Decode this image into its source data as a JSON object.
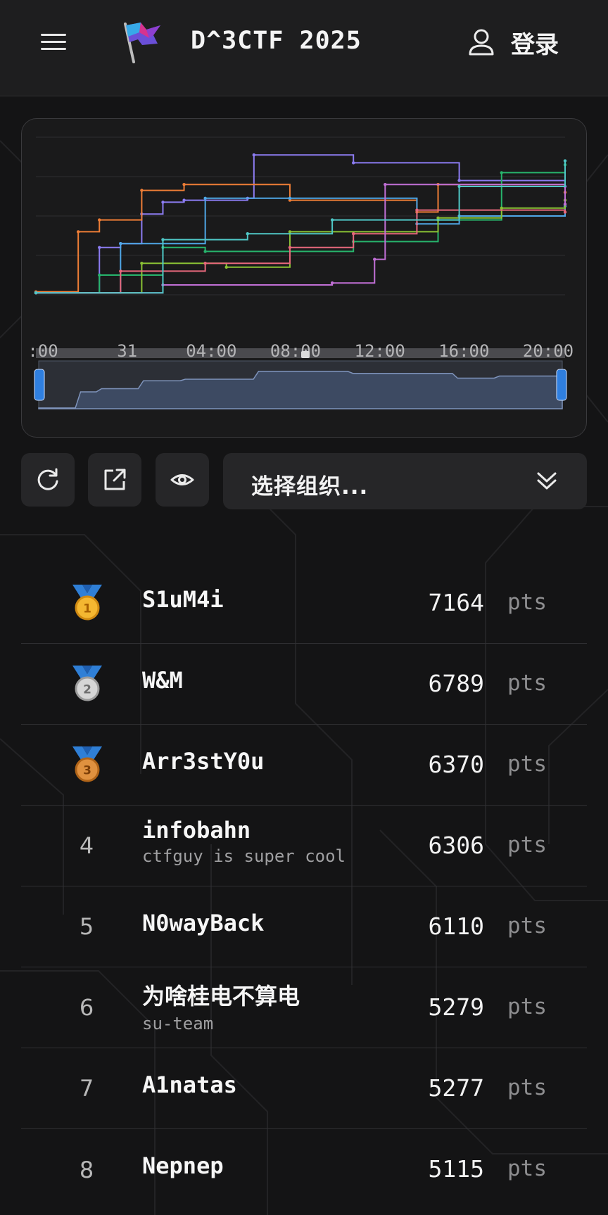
{
  "header": {
    "menu_icon": "hamburger-menu-icon",
    "logo_icon": "flag-logo-icon",
    "title": "D^3CTF 2025",
    "login_icon": "user-icon",
    "login_label": "登录"
  },
  "toolbar": {
    "refresh_icon": "refresh-icon",
    "export_icon": "external-link-icon",
    "visibility_icon": "eye-icon",
    "org_placeholder": "选择组织...",
    "org_chevron_icon": "double-chevron-down-icon"
  },
  "chart_data": {
    "type": "line",
    "x_tick_labels": [
      ":00",
      "31",
      "04:00",
      "08:00",
      "12:00",
      "16:00",
      "20:00"
    ],
    "x_range": [
      0,
      25
    ],
    "y_range": [
      0,
      8000
    ],
    "grid": true,
    "legend": "none",
    "has_range_slider": true,
    "series": [
      {
        "color": "#8c7cf2",
        "values": [
          [
            0,
            100
          ],
          [
            3,
            2400
          ],
          [
            4,
            2600
          ],
          [
            5,
            4100
          ],
          [
            6,
            4700
          ],
          [
            7,
            4800
          ],
          [
            10,
            4900
          ],
          [
            10.3,
            7100
          ],
          [
            15,
            6700
          ],
          [
            20,
            5800
          ],
          [
            25,
            5500
          ]
        ]
      },
      {
        "color": "#ee7d36",
        "values": [
          [
            0,
            150
          ],
          [
            2,
            3200
          ],
          [
            3,
            3800
          ],
          [
            5,
            5300
          ],
          [
            7,
            5600
          ],
          [
            12,
            4800
          ],
          [
            18,
            4200
          ],
          [
            19,
            5600
          ],
          [
            25,
            5200
          ]
        ]
      },
      {
        "color": "#4fa7e8",
        "values": [
          [
            0,
            100
          ],
          [
            4,
            2600
          ],
          [
            8,
            4900
          ],
          [
            12,
            4900
          ],
          [
            18,
            3600
          ],
          [
            20,
            4000
          ],
          [
            25,
            4500
          ]
        ]
      },
      {
        "color": "#27b46c",
        "values": [
          [
            0,
            100
          ],
          [
            3,
            1000
          ],
          [
            6,
            2400
          ],
          [
            8,
            2200
          ],
          [
            15,
            2700
          ],
          [
            19,
            3800
          ],
          [
            22,
            6200
          ],
          [
            25,
            6600
          ]
        ]
      },
      {
        "color": "#8ac234",
        "values": [
          [
            0,
            100
          ],
          [
            5,
            1600
          ],
          [
            9,
            1400
          ],
          [
            12,
            3200
          ],
          [
            19,
            3900
          ],
          [
            22,
            4400
          ],
          [
            25,
            4800
          ]
        ]
      },
      {
        "color": "#e8687c",
        "values": [
          [
            0,
            100
          ],
          [
            4,
            1200
          ],
          [
            8,
            1600
          ],
          [
            12,
            2400
          ],
          [
            15,
            3100
          ],
          [
            18,
            4300
          ],
          [
            25,
            4200
          ]
        ]
      },
      {
        "color": "#c16fd6",
        "values": [
          [
            0,
            100
          ],
          [
            6,
            500
          ],
          [
            14,
            600
          ],
          [
            16,
            1800
          ],
          [
            16.5,
            5600
          ],
          [
            25,
            4600
          ]
        ]
      },
      {
        "color": "#4fc7c6",
        "values": [
          [
            0,
            100
          ],
          [
            6,
            2800
          ],
          [
            10,
            3100
          ],
          [
            14,
            3800
          ],
          [
            20,
            5500
          ],
          [
            25,
            6800
          ]
        ]
      }
    ]
  },
  "leaderboard": [
    {
      "rank": "1",
      "medal": "gold-medal-icon",
      "team": "S1uM4i",
      "score": "7164",
      "unit": "pts"
    },
    {
      "rank": "2",
      "medal": "silver-medal-icon",
      "team": "W&M",
      "score": "6789",
      "unit": "pts"
    },
    {
      "rank": "3",
      "medal": "bronze-medal-icon",
      "team": "Arr3stY0u",
      "score": "6370",
      "unit": "pts"
    },
    {
      "rank": "4",
      "team": "infobahn",
      "subtitle": "ctfguy is super cool",
      "score": "6306",
      "unit": "pts"
    },
    {
      "rank": "5",
      "team": "N0wayBack",
      "score": "6110",
      "unit": "pts"
    },
    {
      "rank": "6",
      "team": "为啥桂电不算电",
      "subtitle": "su-team",
      "score": "5279",
      "unit": "pts"
    },
    {
      "rank": "7",
      "team": "A1natas",
      "score": "5277",
      "unit": "pts"
    },
    {
      "rank": "8",
      "team": "Nepnep",
      "score": "5115",
      "unit": "pts"
    }
  ]
}
